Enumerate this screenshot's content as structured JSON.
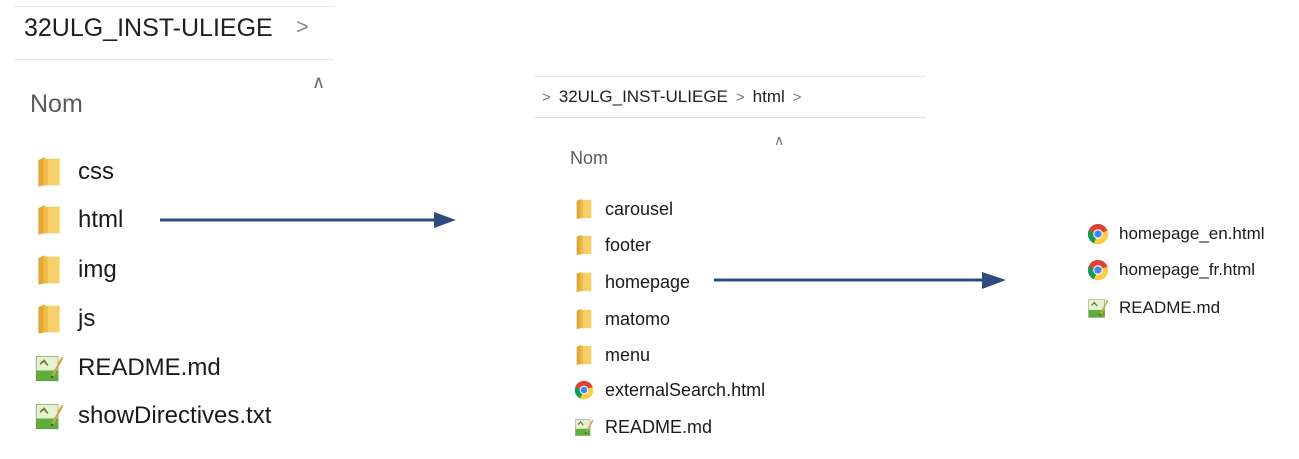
{
  "panel1": {
    "breadcrumb": "32ULG_INST-ULIEGE",
    "breadcrumb_chevron": ">",
    "column_header": "Nom",
    "sort_indicator": "^",
    "items": [
      {
        "name": "css",
        "icon": "folder-icon"
      },
      {
        "name": "html",
        "icon": "folder-icon"
      },
      {
        "name": "img",
        "icon": "folder-icon"
      },
      {
        "name": "js",
        "icon": "folder-icon"
      },
      {
        "name": "README.md",
        "icon": "text-file-icon"
      },
      {
        "name": "showDirectives.txt",
        "icon": "text-file-icon"
      }
    ]
  },
  "panel2": {
    "breadcrumb": [
      "32ULG_INST-ULIEGE",
      "html"
    ],
    "breadcrumb_chevron": ">",
    "column_header": "Nom",
    "sort_indicator": "^",
    "items": [
      {
        "name": "carousel",
        "icon": "folder-icon"
      },
      {
        "name": "footer",
        "icon": "folder-icon"
      },
      {
        "name": "homepage",
        "icon": "folder-icon"
      },
      {
        "name": "matomo",
        "icon": "folder-icon"
      },
      {
        "name": "menu",
        "icon": "folder-icon"
      },
      {
        "name": "externalSearch.html",
        "icon": "chrome-icon"
      },
      {
        "name": "README.md",
        "icon": "text-file-icon"
      }
    ]
  },
  "panel3": {
    "items": [
      {
        "name": "homepage_en.html",
        "icon": "chrome-icon"
      },
      {
        "name": "homepage_fr.html",
        "icon": "chrome-icon"
      },
      {
        "name": "README.md",
        "icon": "text-file-icon"
      }
    ]
  },
  "colors": {
    "arrow": "#2f4b7c",
    "folder": "#f4c25a",
    "folder_dark": "#e0a935"
  }
}
